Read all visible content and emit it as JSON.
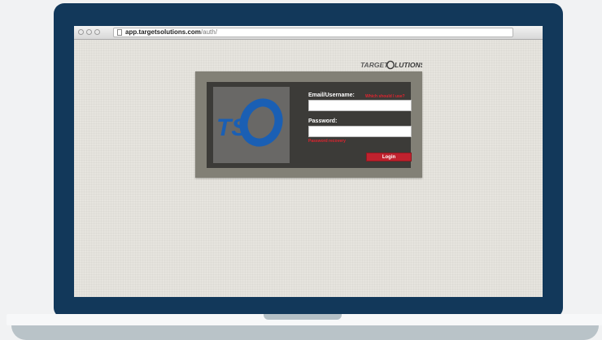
{
  "browser": {
    "url_host": "app.targetsolutions.com",
    "url_path": "/auth/",
    "star_icon": "star-icon"
  },
  "brand": {
    "name": "TARGETSOLUTIONS",
    "tile_logo": "TSO"
  },
  "login": {
    "email_label": "Email/Username:",
    "which_link": "Which should I use?",
    "password_label": "Password:",
    "recovery_link": "Password recovery",
    "login_button": "Login",
    "email_value": "",
    "password_value": ""
  },
  "colors": {
    "frame": "#12385a",
    "accent_red": "#c0222e",
    "tso_blue": "#1a5fb4"
  }
}
